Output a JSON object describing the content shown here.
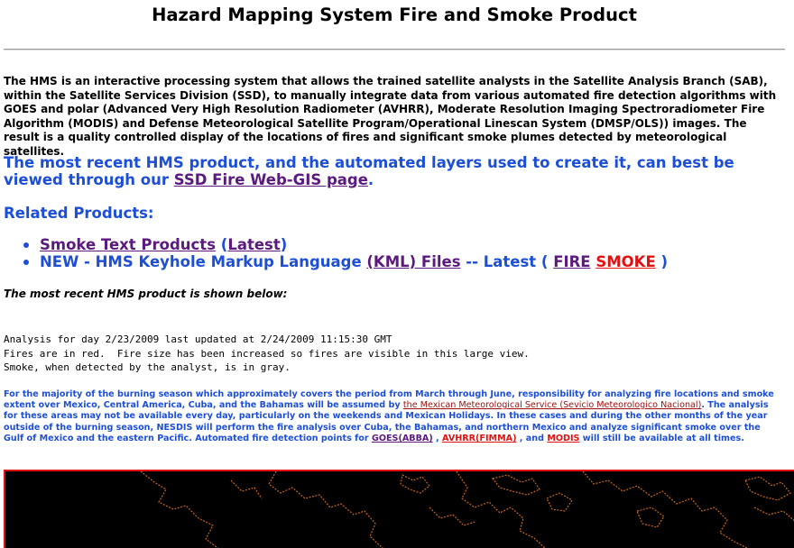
{
  "page": {
    "title": "Hazard Mapping System Fire and Smoke Product"
  },
  "intro": {
    "text": "The HMS is an interactive processing system that allows the trained satellite analysts in the Satellite Analysis Branch (SAB), within the Satellite Services Division (SSD), to manually integrate data from various automated fire detection algorithms with GOES and polar (Advanced Very High Resolution Radiometer (AVHRR), Moderate Resolution Imaging Spectroradiometer Fire Algorithm (MODIS) and Defense Meteorological Satellite Program/Operational Linescan System (DMSP/OLS)) images. The result is a quality controlled display of the locations of fires and significant smoke plumes detected by meteorological satellites."
  },
  "recent": {
    "text_before": "The most recent HMS product, and the automated layers used to create it, can best be viewed through our ",
    "link": "SSD Fire Web-GIS page",
    "text_after": "."
  },
  "related": {
    "heading": "Related Products:",
    "smoke_text": {
      "link": "Smoke Text Products",
      "open": " (",
      "latest": "Latest",
      "close": ")"
    },
    "kml": {
      "prefix": "NEW - HMS Keyhole Markup Language ",
      "link": "(KML) Files",
      "middle": " -- Latest ( ",
      "fire": "FIRE",
      "space": " ",
      "smoke": "SMOKE",
      "suffix": " )"
    }
  },
  "shown_below": "The most recent HMS product is shown below:",
  "analysis": {
    "line1": "Analysis for day 2/23/2009 last updated at 2/24/2009 11:15:30 GMT",
    "line2": "Fires are in red.  Fire size has been increased so fires are visible in this large view.",
    "line3": "Smoke, when detected by the analyst, is in gray."
  },
  "note": {
    "text1": "For the majority of the burning season which approximately covers the period from March through June, responsibility for analyzing fire locations and smoke extent over Mexico, Central America, Cuba, and the Bahamas will be assumed by ",
    "mexican_link": "the Mexican Meteorological Service (Sevicio Meteorologico Nacional)",
    "text2": ". The analysis for these areas may not be available every day, particularly on the weekends and Mexican Holidays. In these cases and during the other months of the year outside of the burning season, NESDIS will perform the fire analysis over Cuba, the Bahamas, and northern Mexico and analyze significant smoke over the Gulf of Mexico and the eastern Pacific. Automated fire detection points for ",
    "goes_link": "GOES(ABBA)",
    "sep1": " , ",
    "avhrr_link": "AVHRR(FIMMA)",
    "sep2": " , and ",
    "modis_link": "MODIS",
    "text3": " will still be available at all times."
  },
  "colors": {
    "heading_blue": "#1d4fd6",
    "visited_link": "#5b1a7e",
    "red_link": "#e01212",
    "map_background": "#000000",
    "map_outline": "#c8641e"
  }
}
